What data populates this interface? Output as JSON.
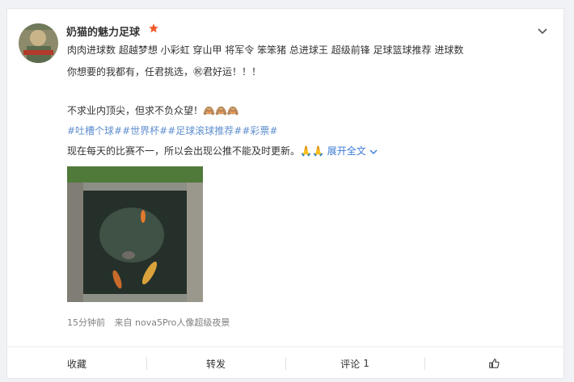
{
  "post": {
    "author": "奶猫的魅力足球",
    "lines": [
      "肉肉进球数 超越梦想 小彩虹 穿山甲 将军令 笨笨猪 总进球王 超级前锋 足球篮球推荐 进球数",
      "你想要的我都有，任君挑选，㊗君好运！！！",
      "不求业内顶尖，但求不负众望！🙈🙈🙈"
    ],
    "hashtags": "#吐槽个球##世界杯##足球滚球推荐##彩票#",
    "last_line": "现在每天的比赛不一，所以会出现公推不能及时更新。🙏🙏",
    "expand_label": "展开全文",
    "time": "15分钟前",
    "source": "来自 nova5Pro人像超级夜景"
  },
  "actions": {
    "favorite": "收藏",
    "repost": "转发",
    "comment": "评论",
    "comment_count": "1"
  },
  "colors": {
    "star": "#f25a2b",
    "link": "#3b7bd4",
    "hashtag": "#5f8fcf"
  }
}
